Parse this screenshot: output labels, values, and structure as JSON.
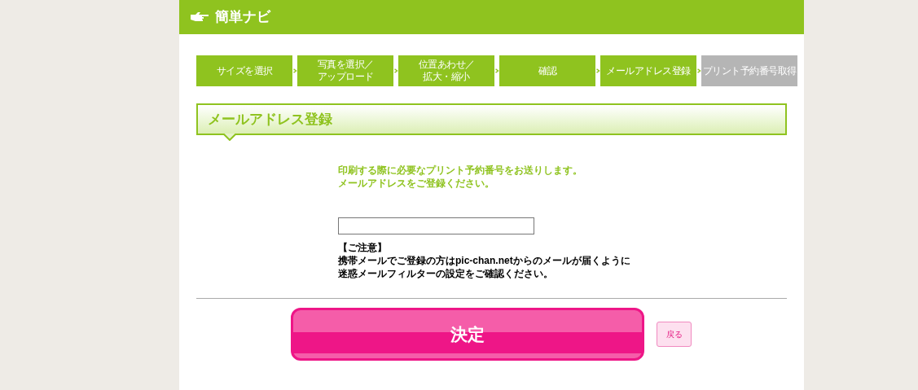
{
  "header": {
    "title": "簡単ナビ"
  },
  "steps": [
    {
      "lines": [
        "サイズを選択"
      ],
      "disabled": false
    },
    {
      "lines": [
        "写真を選択／",
        "アップロード"
      ],
      "disabled": false
    },
    {
      "lines": [
        "位置あわせ／",
        "拡大・縮小"
      ],
      "disabled": false
    },
    {
      "lines": [
        "確認"
      ],
      "disabled": false
    },
    {
      "lines": [
        "メールアドレス登録"
      ],
      "disabled": false
    },
    {
      "lines": [
        "プリント予約番号取得"
      ],
      "disabled": true
    }
  ],
  "section": {
    "title": "メールアドレス登録"
  },
  "intro": [
    "印刷する際に必要なプリント予約番号をお送りします。",
    "メールアドレスをご登録ください。"
  ],
  "notice": {
    "heading": "【ご注意】",
    "body": [
      "携帯メールでご登録の方はpic-chan.netからのメールが届くように",
      "迷惑メールフィルターの設定をご確認ください。"
    ]
  },
  "buttons": {
    "submit": "決定",
    "back": "戻る"
  }
}
